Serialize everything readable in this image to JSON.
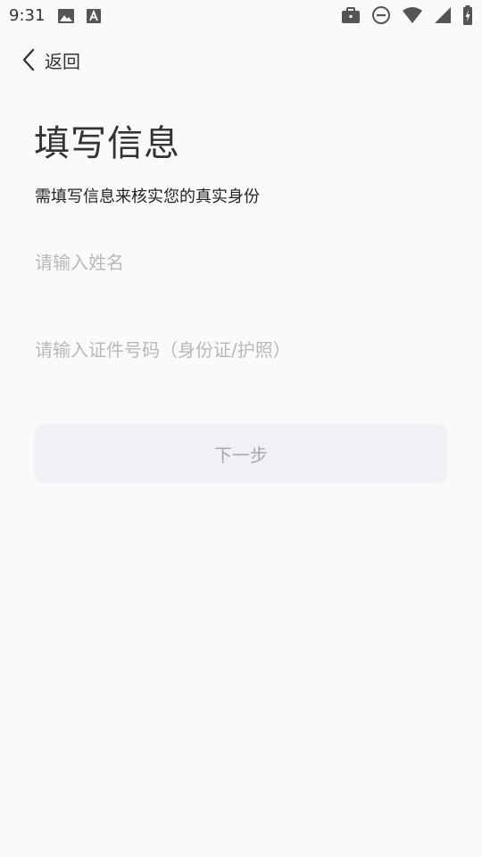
{
  "status_bar": {
    "time": "9:31",
    "left_icons": [
      "image-icon",
      "font-a-icon"
    ],
    "right_icons": [
      "briefcase-icon",
      "do-not-disturb-icon",
      "wifi-icon",
      "signal-icon",
      "battery-charging-icon"
    ]
  },
  "nav": {
    "back_label": "返回"
  },
  "header": {
    "title": "填写信息",
    "subtitle": "需填写信息来核实您的真实身份"
  },
  "form": {
    "name_placeholder": "请输入姓名",
    "id_placeholder": "请输入证件号码（身份证/护照）",
    "next_label": "下一步"
  },
  "colors": {
    "background": "#fafafa",
    "placeholder": "#b8b8bc",
    "button_bg": "#f0f1f5",
    "button_text": "#a8a8ae"
  }
}
